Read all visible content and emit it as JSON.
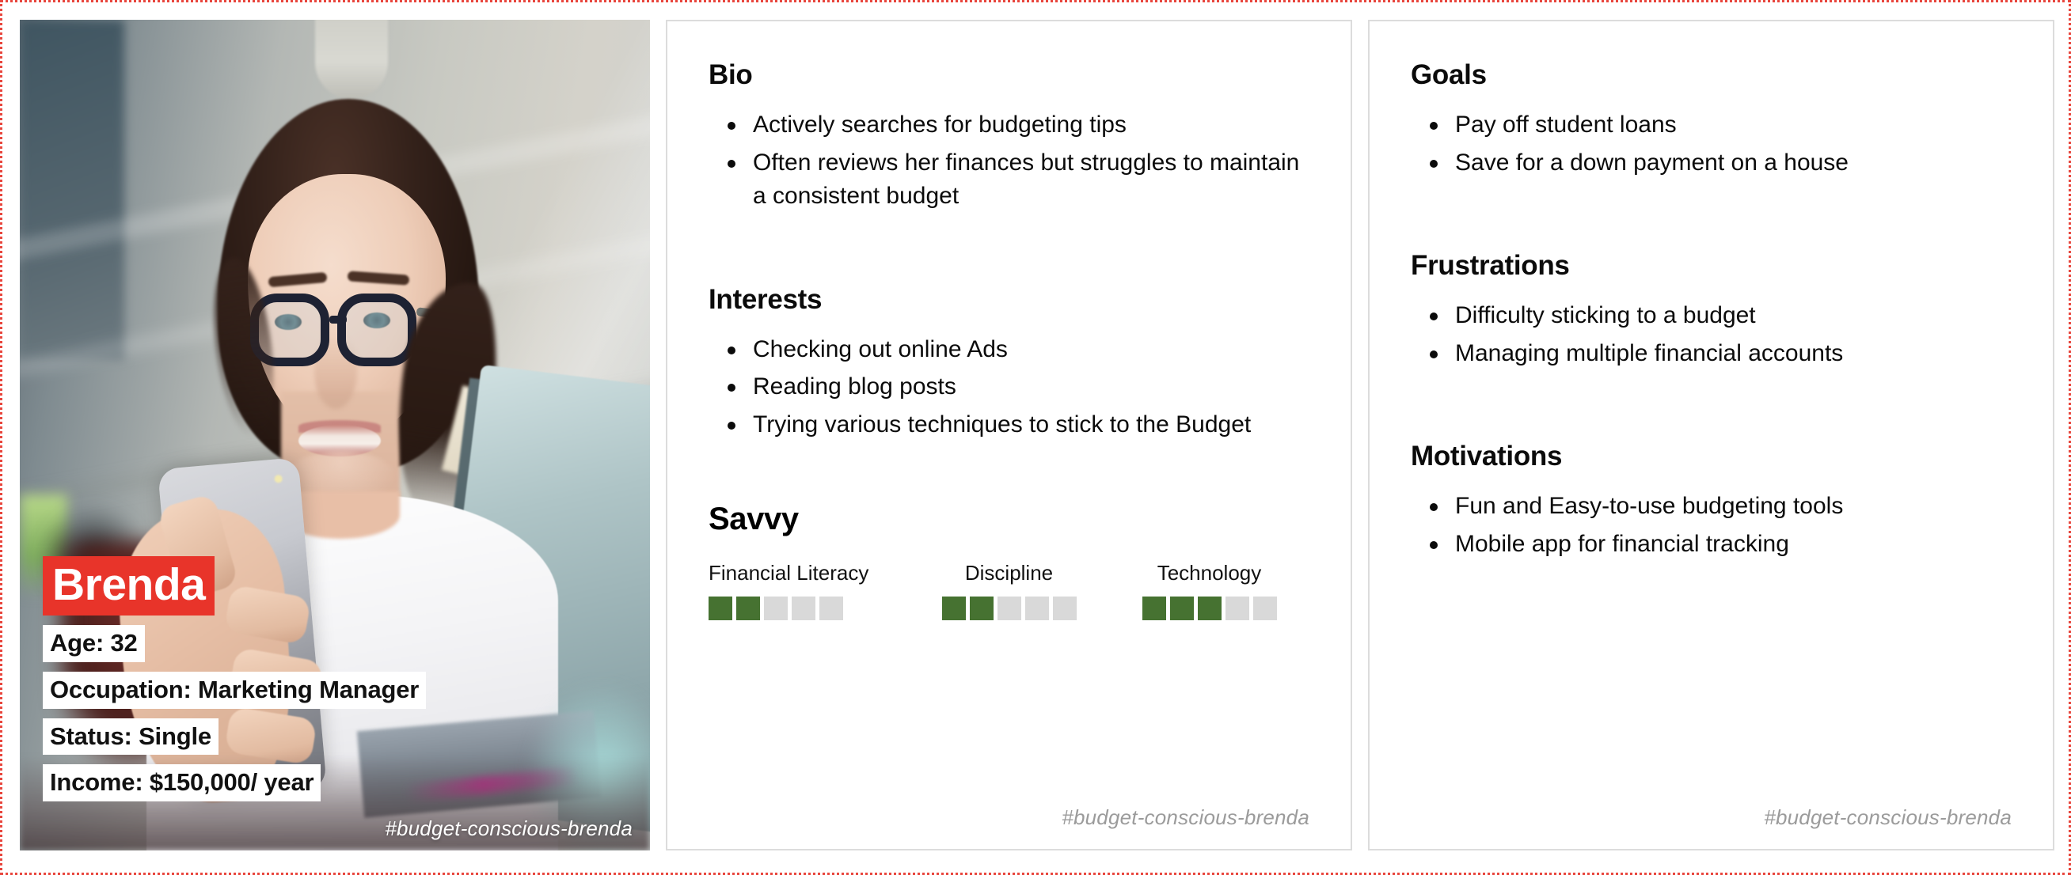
{
  "persona": {
    "name": "Brenda",
    "age_line": "Age: 32",
    "occupation_line": "Occupation: Marketing Manager",
    "status_line": "Status: Single",
    "income_line": "Income: $150,000/ year",
    "hashtag": "#budget-conscious-brenda",
    "accent_red": "#e8342a",
    "meter_on_color": "#467231",
    "meter_off_color": "#d9d9d9",
    "border_accent": "#e8453c"
  },
  "middle_card": {
    "bio": {
      "title": "Bio",
      "items": [
        "Actively searches for budgeting tips",
        "Often reviews her finances but struggles to maintain a consistent budget"
      ]
    },
    "interests": {
      "title": "Interests",
      "items": [
        "Checking out online Ads",
        "Reading blog posts",
        "Trying various techniques to stick to the Budget"
      ]
    },
    "savvy": {
      "title": "Savvy",
      "max": 5,
      "metrics": [
        {
          "label": "Financial Literacy",
          "value": 2
        },
        {
          "label": "Discipline",
          "value": 2
        },
        {
          "label": "Technology",
          "value": 3
        }
      ]
    },
    "footer_hashtag": "#budget-conscious-brenda"
  },
  "right_card": {
    "goals": {
      "title": "Goals",
      "items": [
        "Pay off student loans",
        "Save for a down payment on a house"
      ]
    },
    "frustrations": {
      "title": "Frustrations",
      "items": [
        "Difficulty sticking to a budget",
        "Managing multiple financial accounts"
      ]
    },
    "motivations": {
      "title": "Motivations",
      "items": [
        "Fun and Easy-to-use budgeting tools",
        "Mobile app for financial tracking"
      ]
    },
    "footer_hashtag": "#budget-conscious-brenda"
  }
}
